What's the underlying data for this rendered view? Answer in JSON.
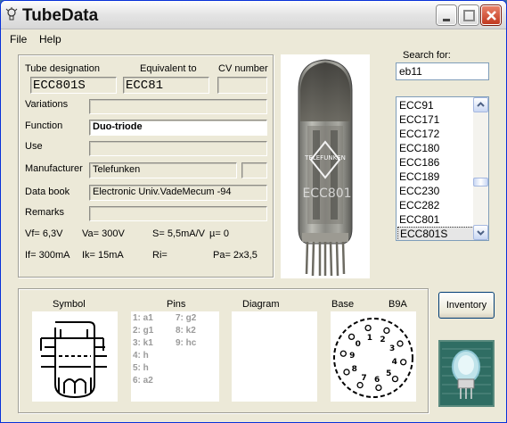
{
  "window": {
    "title": "TubeData"
  },
  "menu": {
    "file": "File",
    "help": "Help"
  },
  "details": {
    "tube_designation_label": "Tube designation",
    "equivalent_label": "Equivalent to",
    "cv_label": "CV number",
    "tube_designation": "ECC801S",
    "equivalent": "ECC81",
    "cv_number": "",
    "variations_label": "Variations",
    "variations": "",
    "function_label": "Function",
    "function": "Duo-triode",
    "use_label": "Use",
    "use": "",
    "manufacturer_label": "Manufacturer",
    "manufacturer": "Telefunken",
    "manufacturer_extra": "",
    "databook_label": "Data book",
    "databook": "Electronic Univ.VadeMecum -94",
    "remarks_label": "Remarks",
    "remarks": ""
  },
  "specs": {
    "vf": "Vf= 6,3V",
    "va": "Va= 300V",
    "s": "S= 5,5mA/V",
    "mu": "µ= 0",
    "if": "If= 300mA",
    "ik": "Ik= 15mA",
    "ri": "Ri=",
    "pa": "Pa= 2x3,5"
  },
  "photo": {
    "brand_text": "TELEFUNKEN",
    "type_text": "ECC801"
  },
  "search": {
    "label": "Search for:",
    "value": "eb11"
  },
  "tube_list": {
    "items": [
      "ECC91",
      "ECC171",
      "ECC172",
      "ECC180",
      "ECC186",
      "ECC189",
      "ECC230",
      "ECC282",
      "ECC801",
      "ECC801S"
    ],
    "selected": "ECC801S"
  },
  "bottom": {
    "symbol_label": "Symbol",
    "pins_label": "Pins",
    "diagram_label": "Diagram",
    "base_label": "Base",
    "base_type": "B9A",
    "pins_col1": [
      "1: a1",
      "2: g1",
      "3: k1",
      "4: h",
      "5: h",
      "6: a2"
    ],
    "pins_col2": [
      "7: g2",
      "8: k2",
      "9: hc"
    ],
    "base_pin_numbers": [
      "1",
      "2",
      "3",
      "4",
      "5",
      "6",
      "7",
      "8",
      "9",
      "0"
    ]
  },
  "actions": {
    "inventory": "Inventory"
  },
  "icons": [
    "app-bulb-icon",
    "minimize-icon",
    "maximize-icon",
    "close-icon",
    "scroll-up-icon",
    "scroll-down-icon",
    "tube-logo-icon"
  ],
  "colors": {
    "title_bar": "#e4e4e4",
    "window_bg": "#ece9d8",
    "close_button": "#c1381f",
    "list_border": "#7f9db9"
  }
}
